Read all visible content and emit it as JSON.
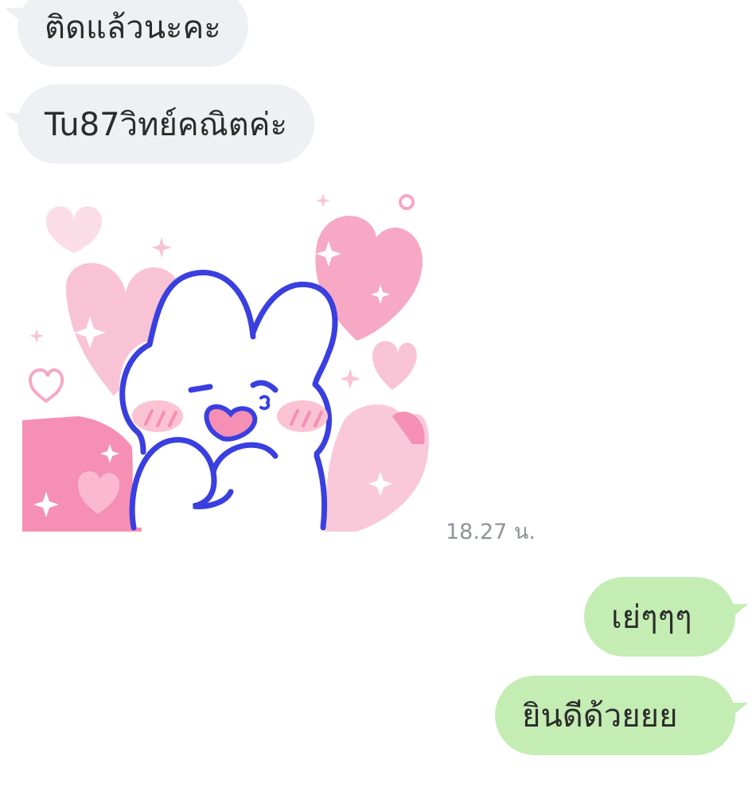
{
  "messages": [
    {
      "direction": "incoming",
      "text": "ติดแล้วนะคะ"
    },
    {
      "direction": "incoming",
      "text": "Tu87วิทย์คณิตค่ะ"
    },
    {
      "direction": "incoming",
      "type": "sticker",
      "sticker": "pink-bunny-hearts-sticker",
      "time": "18.27 น."
    },
    {
      "direction": "outgoing",
      "text": "เย่ๆๆๆ"
    },
    {
      "direction": "outgoing",
      "text": "ยินดีด้วยยย"
    }
  ],
  "colors": {
    "incoming_bubble": "#eef0f3",
    "outgoing_bubble": "#c4edb4",
    "timestamp": "#8f949a",
    "bunny_outline": "#3a3fe0",
    "heart_pink": "#f6a8c4"
  }
}
